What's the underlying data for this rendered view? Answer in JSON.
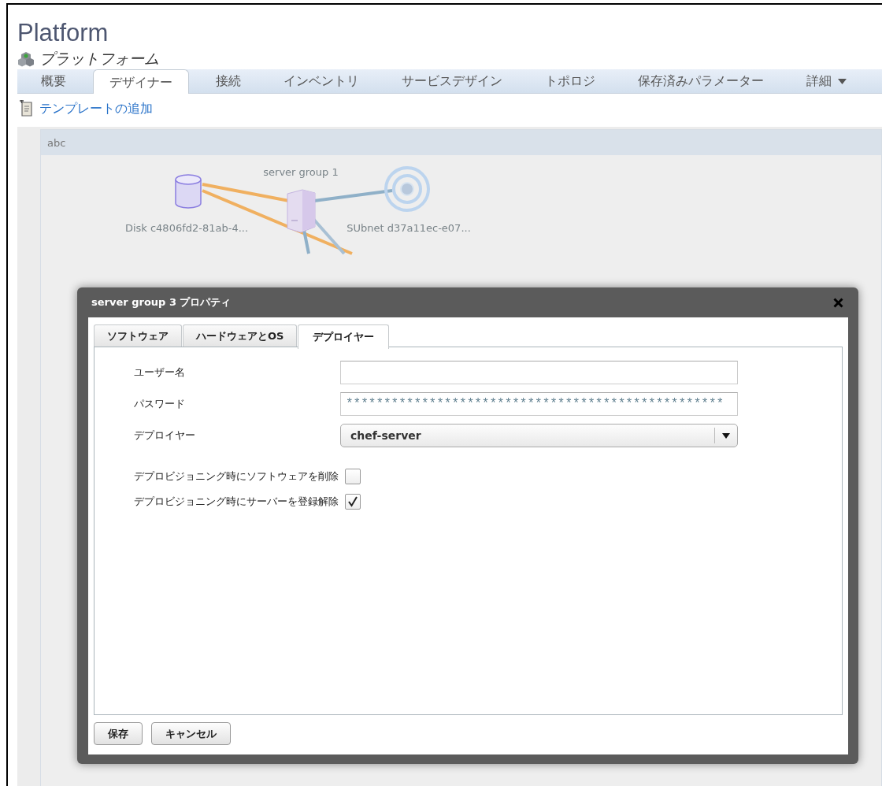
{
  "header": {
    "title": "Platform",
    "subtitle": "プラットフォーム"
  },
  "tabs": [
    {
      "label": "概要",
      "selected": false,
      "kind": "tab"
    },
    {
      "label": "デザイナー",
      "selected": true,
      "kind": "tab"
    },
    {
      "label": "接続",
      "selected": false,
      "kind": "tab"
    },
    {
      "label": "インベントリ",
      "selected": false,
      "kind": "tab"
    },
    {
      "label": "サービスデザイン",
      "selected": false,
      "kind": "tab"
    },
    {
      "label": "トポロジ",
      "selected": false,
      "kind": "tab"
    },
    {
      "label": "保存済みパラメーター",
      "selected": false,
      "kind": "tab"
    },
    {
      "label": "詳細",
      "selected": false,
      "kind": "menu"
    }
  ],
  "actions": [
    {
      "label": "テンプレートの追加"
    }
  ],
  "canvas": {
    "panel_title": "abc",
    "nodes": [
      {
        "kind": "disk",
        "label": "Disk c4806fd2-81ab-4..."
      },
      {
        "kind": "server",
        "label": "server group 1"
      },
      {
        "kind": "subnet",
        "label": "SUbnet d37a11ec-e07..."
      }
    ]
  },
  "dialog": {
    "title": "server group 3 プロパティ",
    "tabs": [
      {
        "label": "ソフトウェア",
        "selected": false
      },
      {
        "label": "ハードウェアとOS",
        "selected": false
      },
      {
        "label": "デプロイヤー",
        "selected": true
      }
    ],
    "fields": [
      {
        "kind": "text",
        "label": "ユーザー名"
      },
      {
        "kind": "password",
        "label": "パスワード",
        "value": "**************************************************"
      },
      {
        "kind": "select",
        "label": "デプロイヤー",
        "value": "chef-server"
      },
      {
        "kind": "checkbox",
        "label": "デプロビジョニング時にソフトウェアを削除",
        "checked": false
      },
      {
        "kind": "checkbox",
        "label": "デプロビジョニング時にサーバーを登録解除",
        "checked": true
      }
    ],
    "buttons": [
      "保存",
      "キャンセル"
    ]
  }
}
